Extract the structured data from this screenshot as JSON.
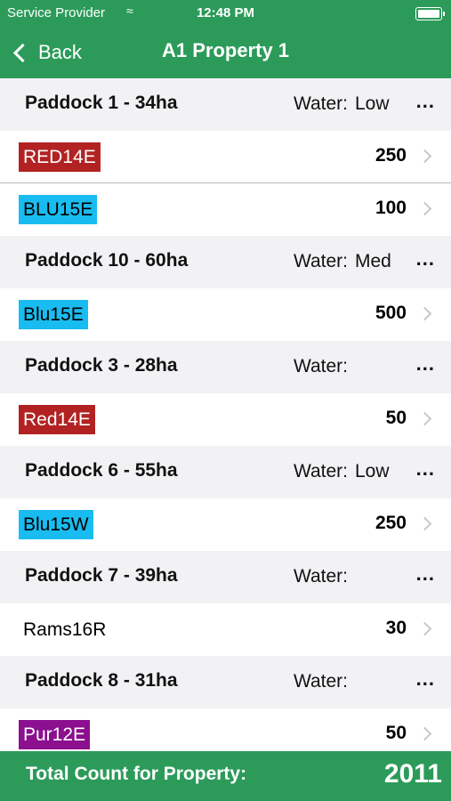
{
  "status_bar": {
    "carrier": "Service Provider",
    "time": "12:48 PM"
  },
  "nav": {
    "back_label": "Back",
    "title": "A1 Property 1"
  },
  "paddocks": [
    {
      "name": "Paddock 1 - 34ha",
      "water_label": "Water:",
      "water": "Low",
      "more": "...",
      "mobs": [
        {
          "tag": "RED14E",
          "color": "red",
          "count": "250"
        },
        {
          "tag": "BLU15E",
          "color": "blue",
          "count": "100"
        }
      ]
    },
    {
      "name": "Paddock 10 - 60ha",
      "water_label": "Water:",
      "water": "Med",
      "more": "...",
      "mobs": [
        {
          "tag": "Blu15E",
          "color": "blue",
          "count": "500"
        }
      ]
    },
    {
      "name": "Paddock 3 - 28ha",
      "water_label": "Water:",
      "water": "",
      "more": "...",
      "mobs": [
        {
          "tag": "Red14E",
          "color": "red",
          "count": "50"
        }
      ]
    },
    {
      "name": "Paddock 6 - 55ha",
      "water_label": "Water:",
      "water": "Low",
      "more": "...",
      "mobs": [
        {
          "tag": "Blu15W",
          "color": "blue",
          "count": "250"
        }
      ]
    },
    {
      "name": "Paddock 7 - 39ha",
      "water_label": "Water:",
      "water": "",
      "more": "...",
      "mobs": [
        {
          "tag": "Rams16R",
          "color": "plain",
          "count": "30"
        }
      ]
    },
    {
      "name": "Paddock 8 - 31ha",
      "water_label": "Water:",
      "water": "",
      "more": "...",
      "mobs": [
        {
          "tag": "Pur12E",
          "color": "purple",
          "count": "50"
        }
      ]
    }
  ],
  "footer": {
    "label": "Total Count for Property:",
    "total": "2011"
  },
  "colors": {
    "header_green": "#2c9b5a",
    "tag_red": "#b22222",
    "tag_blue": "#19bcf0",
    "tag_purple": "#8b0f8e"
  }
}
